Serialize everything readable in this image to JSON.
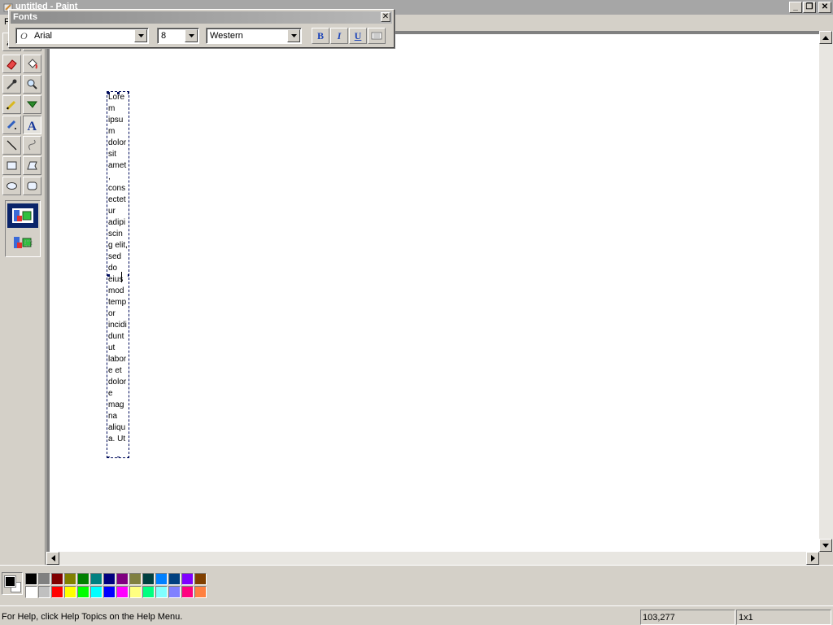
{
  "window": {
    "title": "untitled - Paint",
    "controls": {
      "minimize": "_",
      "restore": "❐",
      "close": "✕"
    }
  },
  "menubar": {
    "first_item": "F"
  },
  "fonts_toolbar": {
    "title": "Fonts",
    "close": "✕",
    "font_name": "Arial",
    "font_size": "8",
    "script": "Western",
    "bold_label": "B",
    "italic_label": "I",
    "underline_label": "U"
  },
  "tools": [
    {
      "name": "free-form-select-tool",
      "pressed": false
    },
    {
      "name": "select-tool",
      "pressed": false
    },
    {
      "name": "eraser-tool",
      "pressed": false
    },
    {
      "name": "fill-with-color-tool",
      "pressed": false
    },
    {
      "name": "pick-color-tool",
      "pressed": false
    },
    {
      "name": "magnifier-tool",
      "pressed": false
    },
    {
      "name": "pencil-tool",
      "pressed": false
    },
    {
      "name": "brush-tool",
      "pressed": false
    },
    {
      "name": "airbrush-tool",
      "pressed": false
    },
    {
      "name": "text-tool",
      "pressed": true
    },
    {
      "name": "line-tool",
      "pressed": false
    },
    {
      "name": "curve-tool",
      "pressed": false
    },
    {
      "name": "rectangle-tool",
      "pressed": false
    },
    {
      "name": "polygon-tool",
      "pressed": false
    },
    {
      "name": "ellipse-tool",
      "pressed": false
    },
    {
      "name": "rounded-rectangle-tool",
      "pressed": false
    }
  ],
  "text_box": {
    "lines": [
      "Lore",
      "m",
      "ipsu",
      "m",
      "dolor",
      "sit",
      "amet",
      ",",
      "cons",
      "ectet",
      "ur",
      "adipi",
      "scin",
      "g elit,",
      "sed",
      "do",
      "eius",
      "mod",
      "temp",
      "or",
      "incidi",
      "dunt",
      "ut",
      "labor",
      "e et",
      "dolor",
      "e",
      "mag",
      "na",
      "aliqu",
      "a. Ut"
    ]
  },
  "colors": {
    "foreground": "#000000",
    "background": "#ffffff",
    "palette": [
      "#000000",
      "#808080",
      "#800000",
      "#808000",
      "#008000",
      "#008080",
      "#000080",
      "#800080",
      "#808040",
      "#004040",
      "#0080ff",
      "#004080",
      "#8000ff",
      "#804000",
      "#ffffff",
      "#c0c0c0",
      "#ff0000",
      "#ffff00",
      "#00ff00",
      "#00ffff",
      "#0000ff",
      "#ff00ff",
      "#ffff80",
      "#00ff80",
      "#80ffff",
      "#8080ff",
      "#ff0080",
      "#ff8040"
    ]
  },
  "status": {
    "help": "For Help, click Help Topics on the Help Menu.",
    "coords": "103,277",
    "size": "1x1"
  }
}
